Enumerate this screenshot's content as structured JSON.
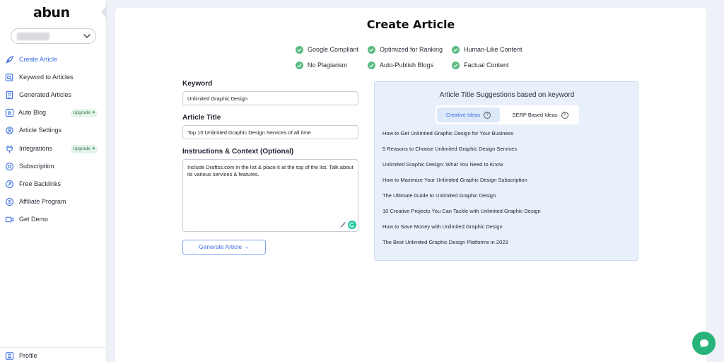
{
  "brand": {
    "name": "abun"
  },
  "sidebar": {
    "workspace_selector": {
      "value": ""
    },
    "items": [
      {
        "label": "Create Article",
        "icon": "feather-icon",
        "active": true
      },
      {
        "label": "Keyword to Articles",
        "icon": "keyword-search-icon"
      },
      {
        "label": "Generated Articles",
        "icon": "document-icon"
      },
      {
        "label": "Auto Blog",
        "icon": "auto-blog-icon",
        "badge": "Upgrade"
      },
      {
        "label": "Article Settings",
        "icon": "settings-icon"
      },
      {
        "label": "Integrations",
        "icon": "plug-icon",
        "badge": "Upgrade"
      },
      {
        "label": "Subscription",
        "icon": "subscription-icon"
      },
      {
        "label": "Free Backlinks",
        "icon": "link-icon"
      },
      {
        "label": "Affiliate Program",
        "icon": "dollar-icon"
      },
      {
        "label": "Get Demo",
        "icon": "video-icon"
      }
    ],
    "profile": {
      "label": "Profile",
      "icon": "profile-icon"
    }
  },
  "main": {
    "title": "Create Article",
    "features": [
      "Google Compliant",
      "Optimized for Ranking",
      "Human-Like Content",
      "No Plagiarism",
      "Auto-Publish Blogs",
      "Factual Content"
    ],
    "form": {
      "keyword_label": "Keyword",
      "keyword_value": "Unlimited Graphic Design",
      "title_label": "Article Title",
      "title_value": "Top 10 Unlimited Graphic Design Services of all time",
      "instructions_label": "Instructions & Context (Optional)",
      "instructions_value": "Include Draftss.com in the list & place it at the top of the list. Talk about its various services & features.",
      "generate_label": "Generate Article →"
    },
    "suggestions": {
      "title": "Article Title Suggestions based on keyword",
      "tabs": [
        {
          "label": "Creative Ideas",
          "active": true
        },
        {
          "label": "SERP Based Ideas",
          "active": false
        }
      ],
      "help_glyph": "?",
      "items": [
        "How to Get Unlimited Graphic Design for Your Business",
        "5 Reasons to Choose Unlimited Graphic Design Services",
        "Unlimited Graphic Design: What You Need to Know",
        "How to Maximize Your Unlimited Graphic Design Subscription",
        "The Ultimate Guide to Unlimited Graphic Design",
        "10 Creative Projects You Can Tackle with Unlimited Graphic Design",
        "How to Save Money with Unlimited Graphic Design",
        "The Best Unlimited Graphic Design Platforms in 2023"
      ]
    }
  },
  "colors": {
    "accent": "#3b6fe0",
    "check": "#5dbb83",
    "chat": "#27b37a",
    "suggest_bg": "#e8f0fb"
  }
}
